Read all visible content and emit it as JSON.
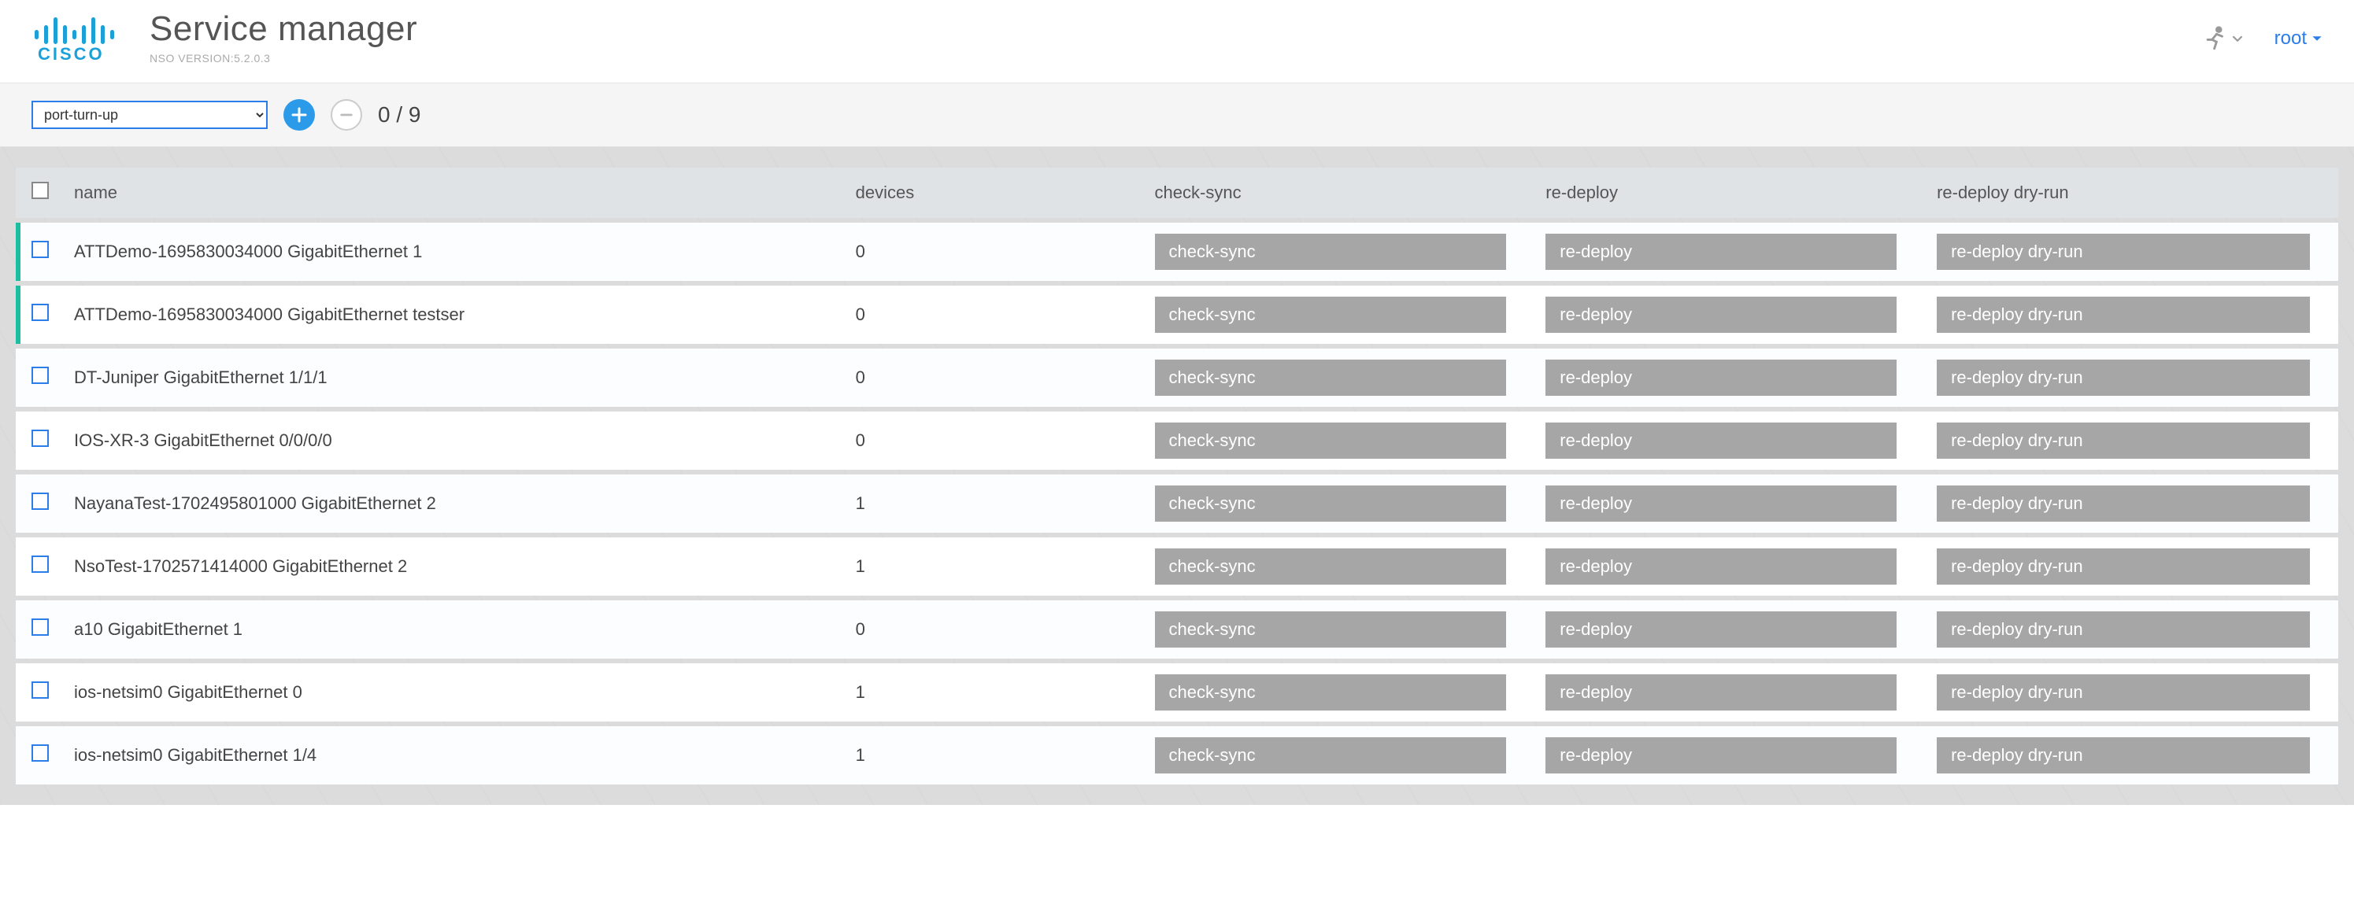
{
  "header": {
    "title": "Service manager",
    "subtitle": "NSO VERSION:5.2.0.3",
    "user": "root"
  },
  "toolbar": {
    "selectValue": "port-turn-up",
    "counter": "0 / 9"
  },
  "columns": {
    "name": "name",
    "devices": "devices",
    "checkSync": "check-sync",
    "redeploy": "re-deploy",
    "redeployDry": "re-deploy dry-run"
  },
  "buttons": {
    "checkSync": "check-sync",
    "redeploy": "re-deploy",
    "redeployDry": "re-deploy dry-run"
  },
  "rows": [
    {
      "name": "ATTDemo-1695830034000 GigabitEthernet 1",
      "devices": "0",
      "highlighted": true
    },
    {
      "name": "ATTDemo-1695830034000 GigabitEthernet testser",
      "devices": "0",
      "highlighted": true
    },
    {
      "name": "DT-Juniper GigabitEthernet 1/1/1",
      "devices": "0",
      "highlighted": false
    },
    {
      "name": "IOS-XR-3 GigabitEthernet 0/0/0/0",
      "devices": "0",
      "highlighted": false
    },
    {
      "name": "NayanaTest-1702495801000 GigabitEthernet 2",
      "devices": "1",
      "highlighted": false
    },
    {
      "name": "NsoTest-1702571414000 GigabitEthernet 2",
      "devices": "1",
      "highlighted": false
    },
    {
      "name": "a10 GigabitEthernet 1",
      "devices": "0",
      "highlighted": false
    },
    {
      "name": "ios-netsim0 GigabitEthernet 0",
      "devices": "1",
      "highlighted": false
    },
    {
      "name": "ios-netsim0 GigabitEthernet 1/4",
      "devices": "1",
      "highlighted": false
    }
  ]
}
